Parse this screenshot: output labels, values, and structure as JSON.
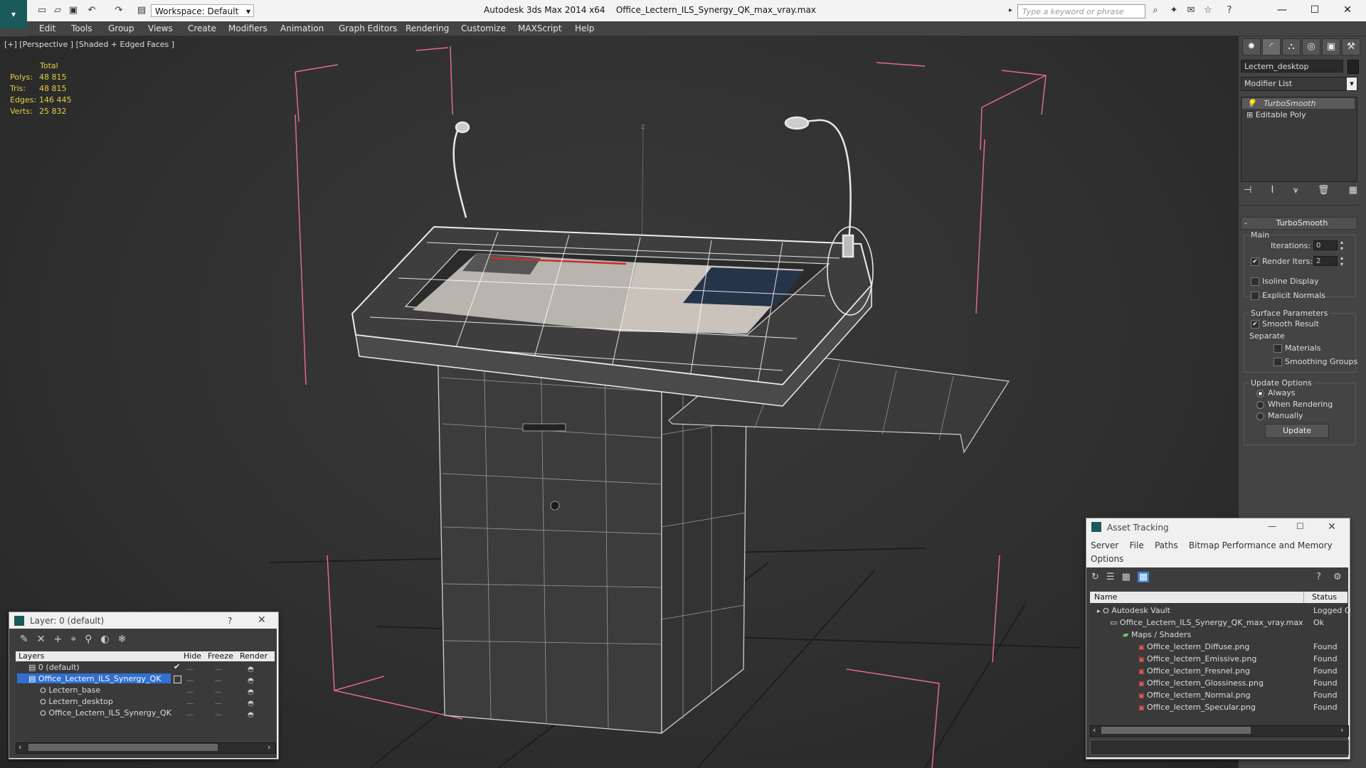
{
  "window": {
    "app_title": "Autodesk 3ds Max  2014 x64",
    "file_title": "Office_Lectern_ILS_Synergy_QK_max_vray.max",
    "workspace": "Workspace: Default",
    "search_placeholder": "Type a keyword or phrase"
  },
  "menu": [
    "Edit",
    "Tools",
    "Group",
    "Views",
    "Create",
    "Modifiers",
    "Animation",
    "Graph Editors",
    "Rendering",
    "Customize",
    "MAXScript",
    "Help"
  ],
  "viewport": {
    "label": "[+] [Perspective ] [Shaded + Edged Faces ]",
    "stats": {
      "header": "Total",
      "rows": [
        {
          "label": "Polys:",
          "value": "48 815"
        },
        {
          "label": "Tris:",
          "value": "48 815"
        },
        {
          "label": "Edges:",
          "value": "146 445"
        },
        {
          "label": "Verts:",
          "value": "25 832"
        }
      ]
    },
    "axis_label": "z"
  },
  "command_panel": {
    "object_name": "Lectern_desktop",
    "modifier_list": "Modifier List",
    "stack": [
      "TurboSmooth",
      "Editable Poly"
    ],
    "rollout": "TurboSmooth",
    "main_label": "Main",
    "iterations_label": "Iterations:",
    "iterations_value": "0",
    "render_iters_label": "Render Iters:",
    "render_iters_value": "2",
    "isoline": "Isoline Display",
    "explicit": "Explicit Normals",
    "surface_params": "Surface Parameters",
    "smooth_result": "Smooth Result",
    "separate": "Separate",
    "materials": "Materials",
    "smoothing_groups": "Smoothing Groups",
    "update_options": "Update Options",
    "always": "Always",
    "when_rendering": "When Rendering",
    "manually": "Manually",
    "update_btn": "Update"
  },
  "layer_panel": {
    "title": "Layer: 0 (default)",
    "help": "?",
    "cols": [
      "Layers",
      "Hide",
      "Freeze",
      "Render"
    ],
    "rows": [
      {
        "name": "0 (default)"
      },
      {
        "name": "Office_Lectern_ILS_Synergy_QK"
      },
      {
        "name": "Lectern_base"
      },
      {
        "name": "Lectern_desktop"
      },
      {
        "name": "Office_Lectern_ILS_Synergy_QK"
      }
    ]
  },
  "asset_panel": {
    "title": "Asset Tracking",
    "menu": [
      "Server",
      "File",
      "Paths",
      "Bitmap Performance and Memory"
    ],
    "menu2": "Options",
    "cols": [
      "Name",
      "Status"
    ],
    "rows": [
      {
        "name": "Autodesk Vault",
        "status": "Logged O"
      },
      {
        "name": "Office_Lectern_ILS_Synergy_QK_max_vray.max",
        "status": "Ok"
      },
      {
        "name": "Maps / Shaders",
        "status": ""
      },
      {
        "name": "Office_lectern_Diffuse.png",
        "status": "Found"
      },
      {
        "name": "Office_lectern_Emissive.png",
        "status": "Found"
      },
      {
        "name": "Office_lectern_Fresnel.png",
        "status": "Found"
      },
      {
        "name": "Office_lectern_Glossiness.png",
        "status": "Found"
      },
      {
        "name": "Office_lectern_Normal.png",
        "status": "Found"
      },
      {
        "name": "Office_lectern_Specular.png",
        "status": "Found"
      }
    ]
  }
}
